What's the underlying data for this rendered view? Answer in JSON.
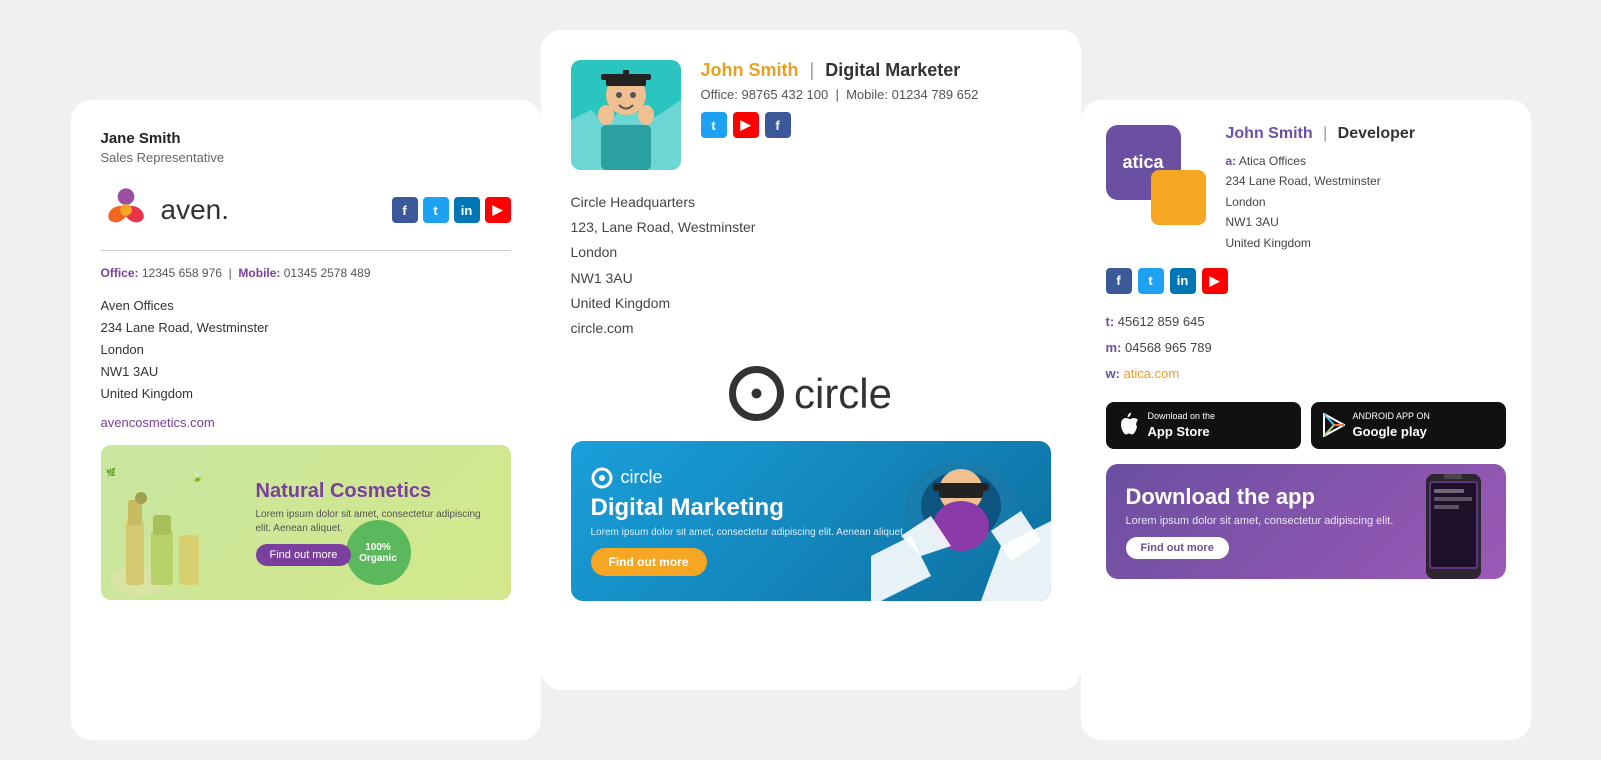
{
  "left": {
    "person_name": "Jane Smith",
    "person_title": "Sales Representative",
    "logo_text": "aven.",
    "office_label": "Office:",
    "office_number": "12345 658 976",
    "mobile_label": "Mobile:",
    "mobile_number": "01345 2578 489",
    "address_line1": "Aven Offices",
    "address_line2": "234 Lane Road, Westminster",
    "address_line3": "London",
    "address_line4": "NW1 3AU",
    "address_line5": "United Kingdom",
    "website": "avencosmetics.com",
    "banner_title": "Natural Cosmetics",
    "banner_desc": "Lorem ipsum dolor sit amet, consectetur adipiscing elit. Aenean aliquet.",
    "banner_btn": "Find out more",
    "banner_organic": "100%\nOrganic"
  },
  "mid": {
    "person_name": "John Smith",
    "person_role": "Digital Marketer",
    "office_label": "Office:",
    "office_number": "98765 432 100",
    "mobile_label": "Mobile:",
    "mobile_number": "01234 789 652",
    "address_name": "Circle Headquarters",
    "address_line1": "123, Lane Road, Westminster",
    "address_line2": "London",
    "address_line3": "NW1 3AU",
    "address_line4": "United Kingdom",
    "address_line5": "circle.com",
    "logo_text": "circle",
    "banner_logo": "circle",
    "banner_title": "Digital Marketing",
    "banner_desc": "Lorem ipsum dolor sit amet, consectetur adipiscing elit. Aenean aliquet.",
    "banner_btn": "Find out more"
  },
  "right": {
    "person_name": "John Smith",
    "person_role": "Developer",
    "logo_text": "atica",
    "address_label": "a:",
    "address_name": "Atica Offices",
    "address_line1": "234 Lane Road, Westminster",
    "address_line2": "London",
    "address_line3": "NW1 3AU",
    "address_line4": "United Kingdom",
    "tel_label": "t:",
    "tel_number": "45612 859 645",
    "mob_label": "m:",
    "mob_number": "04568 965 789",
    "web_label": "w:",
    "website": "atica.com",
    "app_store_sub": "Download on the",
    "app_store_title": "App Store",
    "google_sub": "ANDROID APP ON",
    "google_title": "Google play",
    "banner_title": "Download the app",
    "banner_desc": "Lorem ipsum dolor sit amet, consectetur adipiscing elit.",
    "banner_btn": "Find out more"
  },
  "social": {
    "fb": "f",
    "tw": "t",
    "li": "in",
    "yt": "▶"
  }
}
